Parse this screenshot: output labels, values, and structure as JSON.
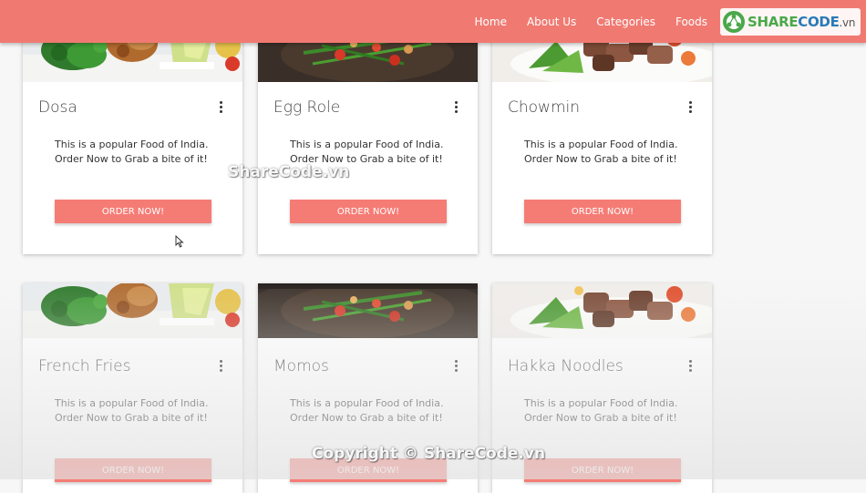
{
  "nav": {
    "links": [
      "Home",
      "About Us",
      "Categories",
      "Foods"
    ],
    "logo": {
      "prefix": "SHARE",
      "main": "CODE",
      "tld": ".vn"
    }
  },
  "cards": [
    {
      "title": "Dosa",
      "desc": [
        "This is a popular Food of India.",
        "Order Now to Grab a bite of it!"
      ],
      "button": "ORDER NOW!",
      "image": "salad-plate"
    },
    {
      "title": "Egg Role",
      "desc": [
        "This is a popular Food of India.",
        "Order Now to Grab a bite of it!"
      ],
      "button": "ORDER NOW!",
      "image": "wok-stirfry"
    },
    {
      "title": "Chowmin",
      "desc": [
        "This is a popular Food of India.",
        "Order Now to Grab a bite of it!"
      ],
      "button": "ORDER NOW!",
      "image": "beef-salad"
    },
    {
      "title": "French Fries",
      "desc": [
        "This is a popular Food of India.",
        "Order Now to Grab a bite of it!"
      ],
      "button": "ORDER NOW!",
      "image": "salad-plate"
    },
    {
      "title": "Momos",
      "desc": [
        "This is a popular Food of India.",
        "Order Now to Grab a bite of it!"
      ],
      "button": "ORDER NOW!",
      "image": "wok-stirfry"
    },
    {
      "title": "Hakka Noodles",
      "desc": [
        "This is a popular Food of India.",
        "Order Now to Grab a bite of it!"
      ],
      "button": "ORDER NOW!",
      "image": "beef-salad"
    }
  ],
  "watermarks": {
    "center": "ShareCode.vn",
    "bottom": "Copyright © ShareCode.vn"
  },
  "colors": {
    "primary": "#f07a72",
    "button": "#f57c75"
  }
}
